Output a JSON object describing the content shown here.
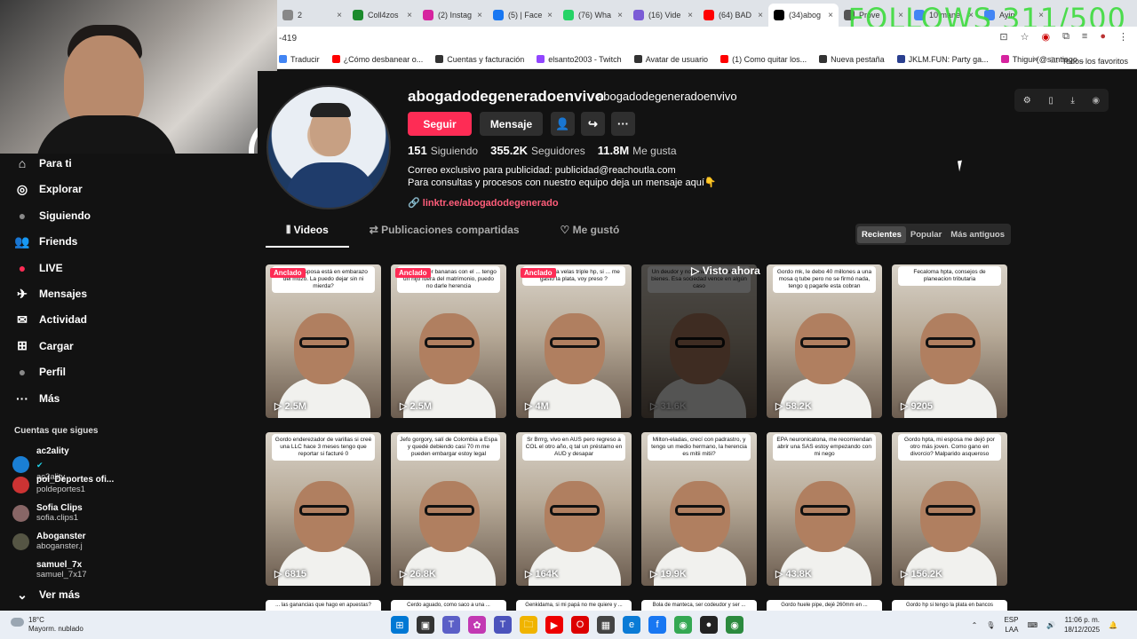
{
  "browser": {
    "tabs": [
      {
        "label": "2",
        "color": "#888",
        "active": false
      },
      {
        "label": "Coll4zos",
        "color": "#1b8a2c",
        "active": false
      },
      {
        "label": "(2) Instag",
        "color": "#d6249f",
        "active": false
      },
      {
        "label": "(5) | Face",
        "color": "#1877f2",
        "active": false
      },
      {
        "label": "(76) Wha",
        "color": "#25d366",
        "active": false
      },
      {
        "label": "(16) Vide",
        "color": "#7b5cd6",
        "active": false
      },
      {
        "label": "(64) BAD",
        "color": "#ff0000",
        "active": false
      },
      {
        "label": "(34)abog",
        "color": "#000000",
        "active": true
      },
      {
        "label": "Prove",
        "color": "#555",
        "active": false
      },
      {
        "label": "10 mane",
        "color": "#4285f4",
        "active": false
      },
      {
        "label": "Ayin",
        "color": "#4285f4",
        "active": false
      }
    ],
    "overlay_text": "FOLLOWS 311/500",
    "address": "-419",
    "bookmarks": [
      {
        "label": "Traducir",
        "color": "#4285f4"
      },
      {
        "label": "¿Cómo desbanear o...",
        "color": "#ff0000"
      },
      {
        "label": "Cuentas y facturación",
        "color": "#333"
      },
      {
        "label": "elsanto2003 - Twitch",
        "color": "#9146ff"
      },
      {
        "label": "Avatar de usuario",
        "color": "#333"
      },
      {
        "label": "(1) Como quitar los...",
        "color": "#ff0000"
      },
      {
        "label": "Nueva pestaña",
        "color": "#333"
      },
      {
        "label": "JKLM.FUN: Party ga...",
        "color": "#2a3f8f"
      },
      {
        "label": "Thigui (@santiago...",
        "color": "#d6249f"
      }
    ],
    "bookmarks_overflow": "»",
    "all_bookmarks": "Todos los favoritos"
  },
  "nav": {
    "items": [
      {
        "label": "Para ti",
        "icon": "home-icon",
        "glyph": "⌂"
      },
      {
        "label": "Explorar",
        "icon": "compass-icon",
        "glyph": "◎"
      },
      {
        "label": "Siguiendo",
        "icon": "following-avatar-icon",
        "glyph": "●"
      },
      {
        "label": "Friends",
        "icon": "friends-icon",
        "glyph": "👥"
      },
      {
        "label": "LIVE",
        "icon": "live-icon",
        "glyph": "●"
      },
      {
        "label": "Mensajes",
        "icon": "messages-icon",
        "glyph": "✈",
        "badge": "14"
      },
      {
        "label": "Actividad",
        "icon": "activity-icon",
        "glyph": "✉",
        "badge": "20"
      },
      {
        "label": "Cargar",
        "icon": "upload-icon",
        "glyph": "⊞"
      },
      {
        "label": "Perfil",
        "icon": "profile-avatar-icon",
        "glyph": "●"
      },
      {
        "label": "Más",
        "icon": "more-icon",
        "glyph": "···"
      }
    ],
    "following_title": "Cuentas que sigues",
    "accounts": [
      {
        "name": "ac2ality",
        "handle": "ac2ality",
        "verified": true,
        "color": "#1a7fd4"
      },
      {
        "name": "pol_Deportes ofi...",
        "handle": "poldeportes1",
        "verified": false,
        "color": "#c33"
      },
      {
        "name": "Sofia Clips",
        "handle": "sofia.clips1",
        "verified": false,
        "color": "#866"
      },
      {
        "name": "Aboganster",
        "handle": "aboganster.j",
        "verified": false,
        "color": "#554"
      },
      {
        "name": "samuel_7x",
        "handle": "samuel_7x17",
        "verified": false,
        "color": "#121212"
      }
    ],
    "see_more": "Ver más"
  },
  "profile": {
    "username": "abogadodegeneradoenvivo",
    "nickname": "abogadodegeneradoenvivo",
    "follow_label": "Seguir",
    "message_label": "Mensaje",
    "stats": [
      {
        "value": "151",
        "label": "Siguiendo"
      },
      {
        "value": "355.2K",
        "label": "Seguidores"
      },
      {
        "value": "11.8M",
        "label": "Me gusta"
      }
    ],
    "bio_line1": "Correo exclusivo para publicidad: publicidad@reachoutla.com",
    "bio_line2": "Para consultas y procesos con nuestro equipo deja un mensaje aquí👇",
    "link": "linktr.ee/abogadodegenerado",
    "tabs": [
      "Videos",
      "Publicaciones compartidas",
      "Me gustó"
    ],
    "sort_options": [
      "Recientes",
      "Popular",
      "Más antiguos"
    ],
    "sort_selected": "Recientes",
    "pinned_label": "Anclado",
    "seen_label": "▷ Visto ahora"
  },
  "videos": [
    {
      "caption": "hpta, mi esposa está en embarazo del mozo. La puedo dejar sin ni mierda?",
      "views": "2.5M",
      "pinned": true,
      "dim": false
    },
    {
      "caption": "enderezador bananas con el ... tengo un hijo fuera del matrimonio, puedo no darle herencia",
      "views": "2.5M",
      "pinned": true,
      "dim": false
    },
    {
      "caption": "Gordo sopla velas triple hp, si ... me gastó la plata, voy preso ?",
      "views": "4M",
      "pinned": true,
      "dim": false
    },
    {
      "caption": "Un deudor y no tiene responsable de bienes. Esa sociedad vence en algún caso",
      "views": "31.6K",
      "pinned": false,
      "dim": true
    },
    {
      "caption": "Gordo mk, le debo 40 millones a una mosa q tube pero no se firmó nada, tengo q pagarle esta cobran",
      "views": "58.2K",
      "pinned": false,
      "dim": false
    },
    {
      "caption": "Fecaloma hpta, consejos de planeacion tributaria",
      "views": "9205",
      "pinned": false,
      "dim": false
    },
    {
      "caption": "Gordo enderezador de varillas si creé una LLC hace 3 meses tengo que reportar si facturé 0",
      "views": "6815",
      "pinned": false,
      "dim": false
    },
    {
      "caption": "Jefo gorgory, salí de Colombia a Espa y quedé debiendo casi 70 m me pueden embargar estoy legal",
      "views": "26.8K",
      "pinned": false,
      "dim": false
    },
    {
      "caption": "Sr Brrrg, vivo en AUS pero regreso a COL el otro año, q tal un préstamo en AUD y desapar",
      "views": "164K",
      "pinned": false,
      "dim": false
    },
    {
      "caption": "Milton-eladas, crecí con padrastro, y tengo un medio hermano, la herencia es mitii mitii?",
      "views": "19.9K",
      "pinned": false,
      "dim": false
    },
    {
      "caption": "EPA neuronicatona, me recomiendan abrir una SAS estoy empezando con mi nego",
      "views": "43.8K",
      "pinned": false,
      "dim": false
    },
    {
      "caption": "Gordo hpta, mi esposa me dejó por otro más joven. Como gano en divorcio? Malparido asqueroso",
      "views": "156.2K",
      "pinned": false,
      "dim": false
    }
  ],
  "videos_partial_row": [
    "... las ganancias que hago en apuestas?",
    "Cerdo aguado, como saco a una ...",
    "Genkidama, si mi papá no me quiere y ...",
    "Bola de manteca, ser codeudor y ser ...",
    "Gordo huele pipe, dejé 260mm en ...",
    "Gordo hp si tengo la plata en bancos"
  ],
  "taskbar": {
    "temp": "18°C",
    "weather": "Mayorm. nublado",
    "lang1": "ESP",
    "lang2": "LAA",
    "time": "11:06 p. m.",
    "date": "18/12/2025"
  }
}
